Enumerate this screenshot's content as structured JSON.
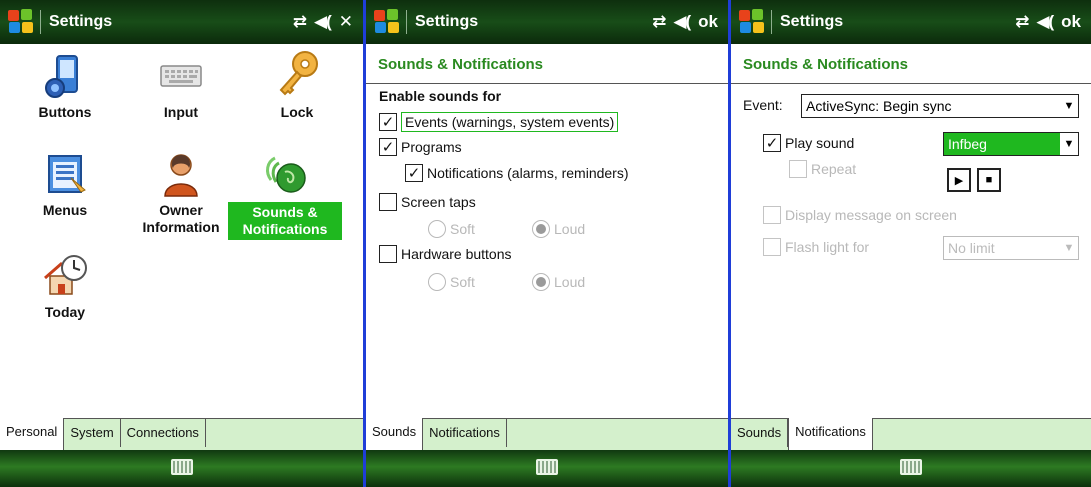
{
  "screen1": {
    "title": "Settings",
    "action": "✕",
    "icons": [
      {
        "label": "Buttons"
      },
      {
        "label": "Input"
      },
      {
        "label": "Lock"
      },
      {
        "label": "Menus"
      },
      {
        "label": "Owner Information"
      },
      {
        "label": "Sounds & Notifications"
      },
      {
        "label": "Today"
      }
    ],
    "tabs": [
      "Personal",
      "System",
      "Connections"
    ]
  },
  "screen2": {
    "title": "Settings",
    "action": "ok",
    "header": "Sounds & Notifications",
    "enable_label": "Enable sounds for",
    "events_label": "Events (warnings, system events)",
    "programs_label": "Programs",
    "notifications_label": "Notifications (alarms, reminders)",
    "screen_taps_label": "Screen taps",
    "hardware_buttons_label": "Hardware buttons",
    "soft_label": "Soft",
    "loud_label": "Loud",
    "tabs": [
      "Sounds",
      "Notifications"
    ]
  },
  "screen3": {
    "title": "Settings",
    "action": "ok",
    "header": "Sounds & Notifications",
    "event_label": "Event:",
    "event_value": "ActiveSync: Begin sync",
    "play_sound_label": "Play sound",
    "sound_value": "Infbeg",
    "repeat_label": "Repeat",
    "display_message_label": "Display message on screen",
    "flash_light_label": "Flash light for",
    "flash_value": "No limit",
    "tabs": [
      "Sounds",
      "Notifications"
    ]
  },
  "colors": {
    "accent_green": "#1fb81f",
    "header_green": "#2a8a20",
    "titlebar": "#184d18",
    "divider": "#1f3ed8",
    "tab_bg": "#d4f0cc"
  },
  "icon_names": [
    "windows-logo-icon",
    "connectivity-icon",
    "volume-icon",
    "keyboard-icon",
    "play-icon",
    "stop-icon"
  ]
}
